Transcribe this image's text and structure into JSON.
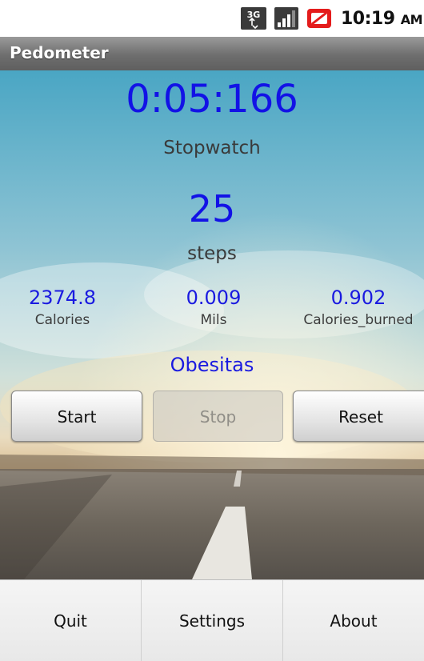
{
  "status_bar": {
    "network": "3G",
    "time": "10:19",
    "ampm": "AM",
    "icons": [
      "3g-data-icon",
      "signal-strength-icon",
      "no-sim-alert-icon"
    ]
  },
  "app": {
    "title": "Pedometer"
  },
  "stopwatch": {
    "value": "0:05:166",
    "label": "Stopwatch"
  },
  "steps": {
    "value": "25",
    "label": "steps"
  },
  "stats": [
    {
      "value": "2374.8",
      "label": "Calories"
    },
    {
      "value": "0.009",
      "label": "Mils"
    },
    {
      "value": "0.902",
      "label": "Calories_burned"
    }
  ],
  "brand": "Obesitas",
  "buttons": {
    "start": "Start",
    "stop": "Stop",
    "reset": "Reset"
  },
  "menu": {
    "quit": "Quit",
    "settings": "Settings",
    "about": "About"
  },
  "colors": {
    "accent_blue": "#1212e6",
    "title_bar": "#6e6e6e"
  }
}
